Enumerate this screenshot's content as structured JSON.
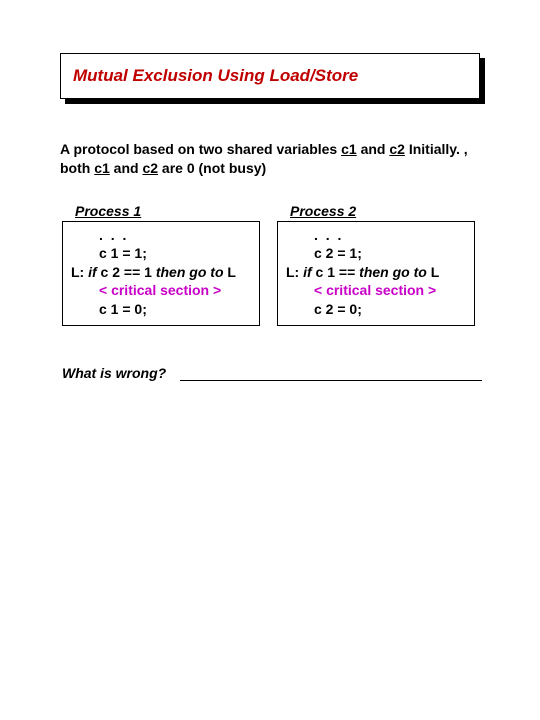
{
  "title": "Mutual Exclusion Using Load/Store",
  "intro_before_c1": "A protocol based on two shared variables ",
  "intro_c1": "c1",
  "intro_mid": " and ",
  "intro_c2": "c2",
  "intro_initially": " Initially. , both ",
  "intro_c1b": "c1",
  "intro_and": " and ",
  "intro_c2b": "c2",
  "intro_after": " are 0 (not busy)",
  "proc1_label": "Process 1",
  "proc2_label": "Process 2",
  "p1": {
    "dots": ". . .",
    "s1": "c 1 = 1;",
    "if_label": "L: ",
    "if_kw": "if",
    "if_cond": " c 2 == 1 ",
    "then_kw": "then go to",
    "if_tail": " L",
    "crit": "< critical section >",
    "s3": "c 1 = 0;"
  },
  "p2": {
    "dots": ". . .",
    "s1": "c 2 = 1;",
    "if_label": "L: ",
    "if_kw": "if",
    "if_cond": " c 1 ==   ",
    "then_kw": "then go to",
    "if_tail": " L",
    "crit": "< critical section >",
    "s3": "c 2 = 0;"
  },
  "prompt": "What is wrong?"
}
